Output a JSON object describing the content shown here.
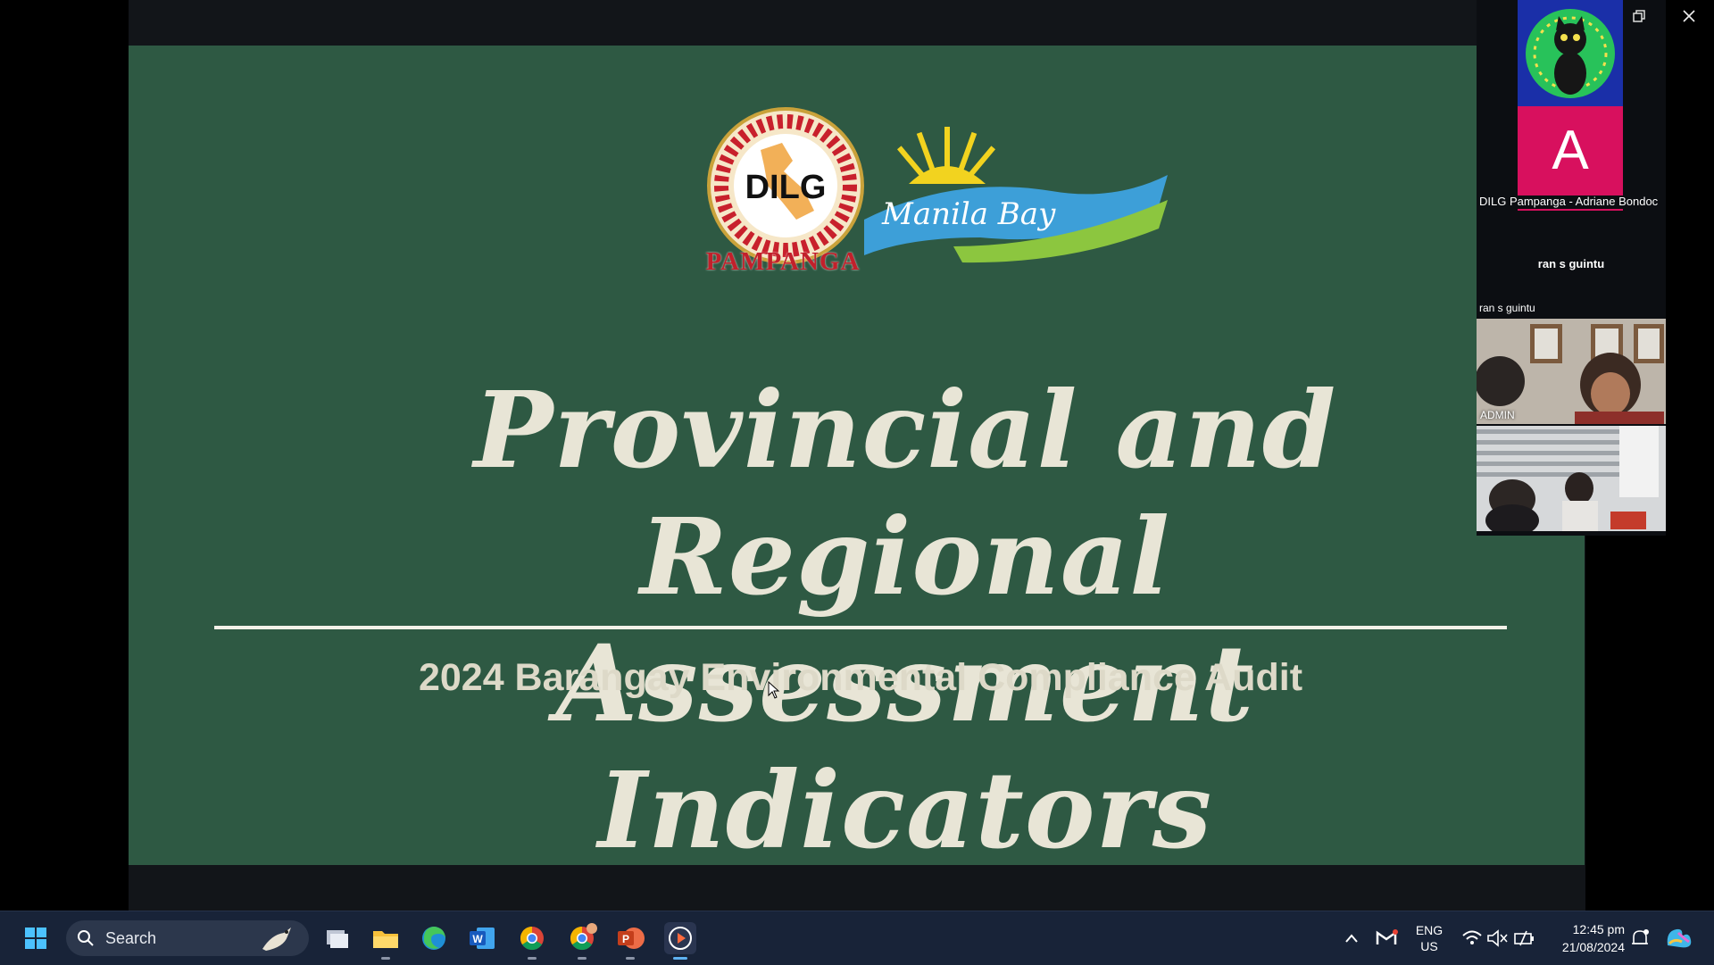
{
  "slide": {
    "logo_text": "DILG",
    "province_text": "PAMPANGA",
    "partner_logo_text": "Manila Bay",
    "title_line1": "Provincial and Regional",
    "title_line2": "Assessment Indicators",
    "subtitle": "2024 Barangay Environmental Compliance Audit"
  },
  "participants": {
    "tile_a_letter": "A",
    "dilg_name": "DILG Pampanga - Adriane Bondoc",
    "ran_center": "ran s guintu",
    "ran_label": "ran s guintu",
    "admin_label": "ADMIN"
  },
  "taskbar": {
    "search_label": "Search",
    "lang_line1": "ENG",
    "lang_line2": "US",
    "time": "12:45 pm",
    "date": "21/08/2024"
  },
  "colors": {
    "slide_bg": "#2e5943",
    "title_text": "#e8e5d6",
    "avatar_bg": "#d8105e",
    "taskbar_bg": "#182338"
  }
}
